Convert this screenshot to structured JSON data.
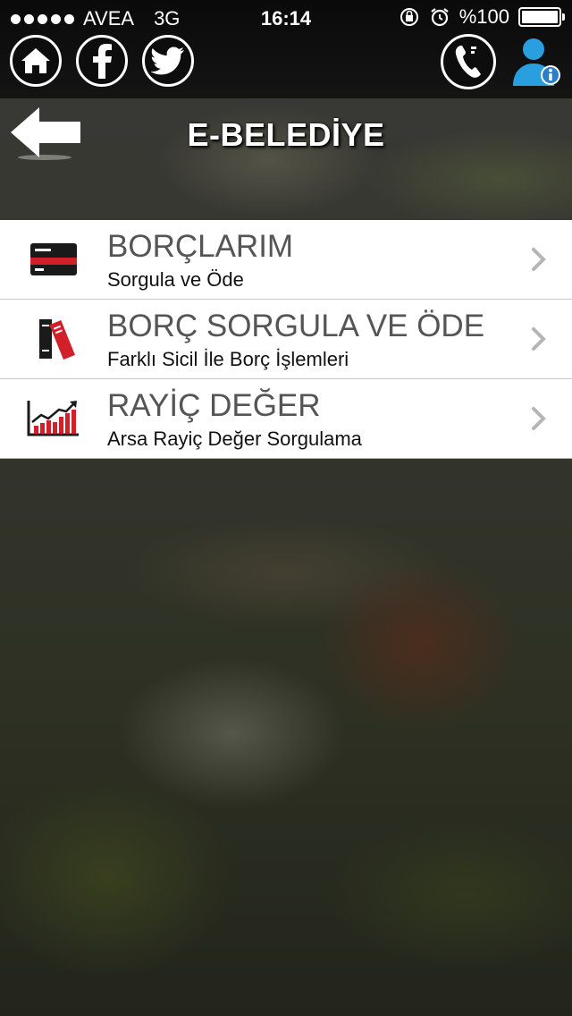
{
  "status_bar": {
    "carrier": "AVEA",
    "network": "3G",
    "time": "16:14",
    "battery": "%100"
  },
  "toolbar": {
    "home_icon": "home-icon",
    "facebook_icon": "facebook-icon",
    "twitter_icon": "twitter-icon",
    "phone_icon": "phone-icon",
    "user_info_icon": "user-info-icon"
  },
  "header": {
    "title": "E-BELEDİYE",
    "back_icon": "back-arrow-icon"
  },
  "menu": [
    {
      "title": "BORÇLARIM",
      "subtitle": "Sorgula ve Öde",
      "icon": "credit-card-icon"
    },
    {
      "title": "BORÇ SORGULA VE ÖDE",
      "subtitle": "Farklı Sicil İle Borç İşlemleri",
      "icon": "books-icon"
    },
    {
      "title": "RAYİÇ DEĞER",
      "subtitle": "Arsa Rayiç Değer Sorgulama",
      "icon": "chart-trend-icon"
    }
  ],
  "colors": {
    "accent_red": "#d0212a",
    "list_title": "#555555",
    "user_icon_blue": "#2a9fe0"
  }
}
